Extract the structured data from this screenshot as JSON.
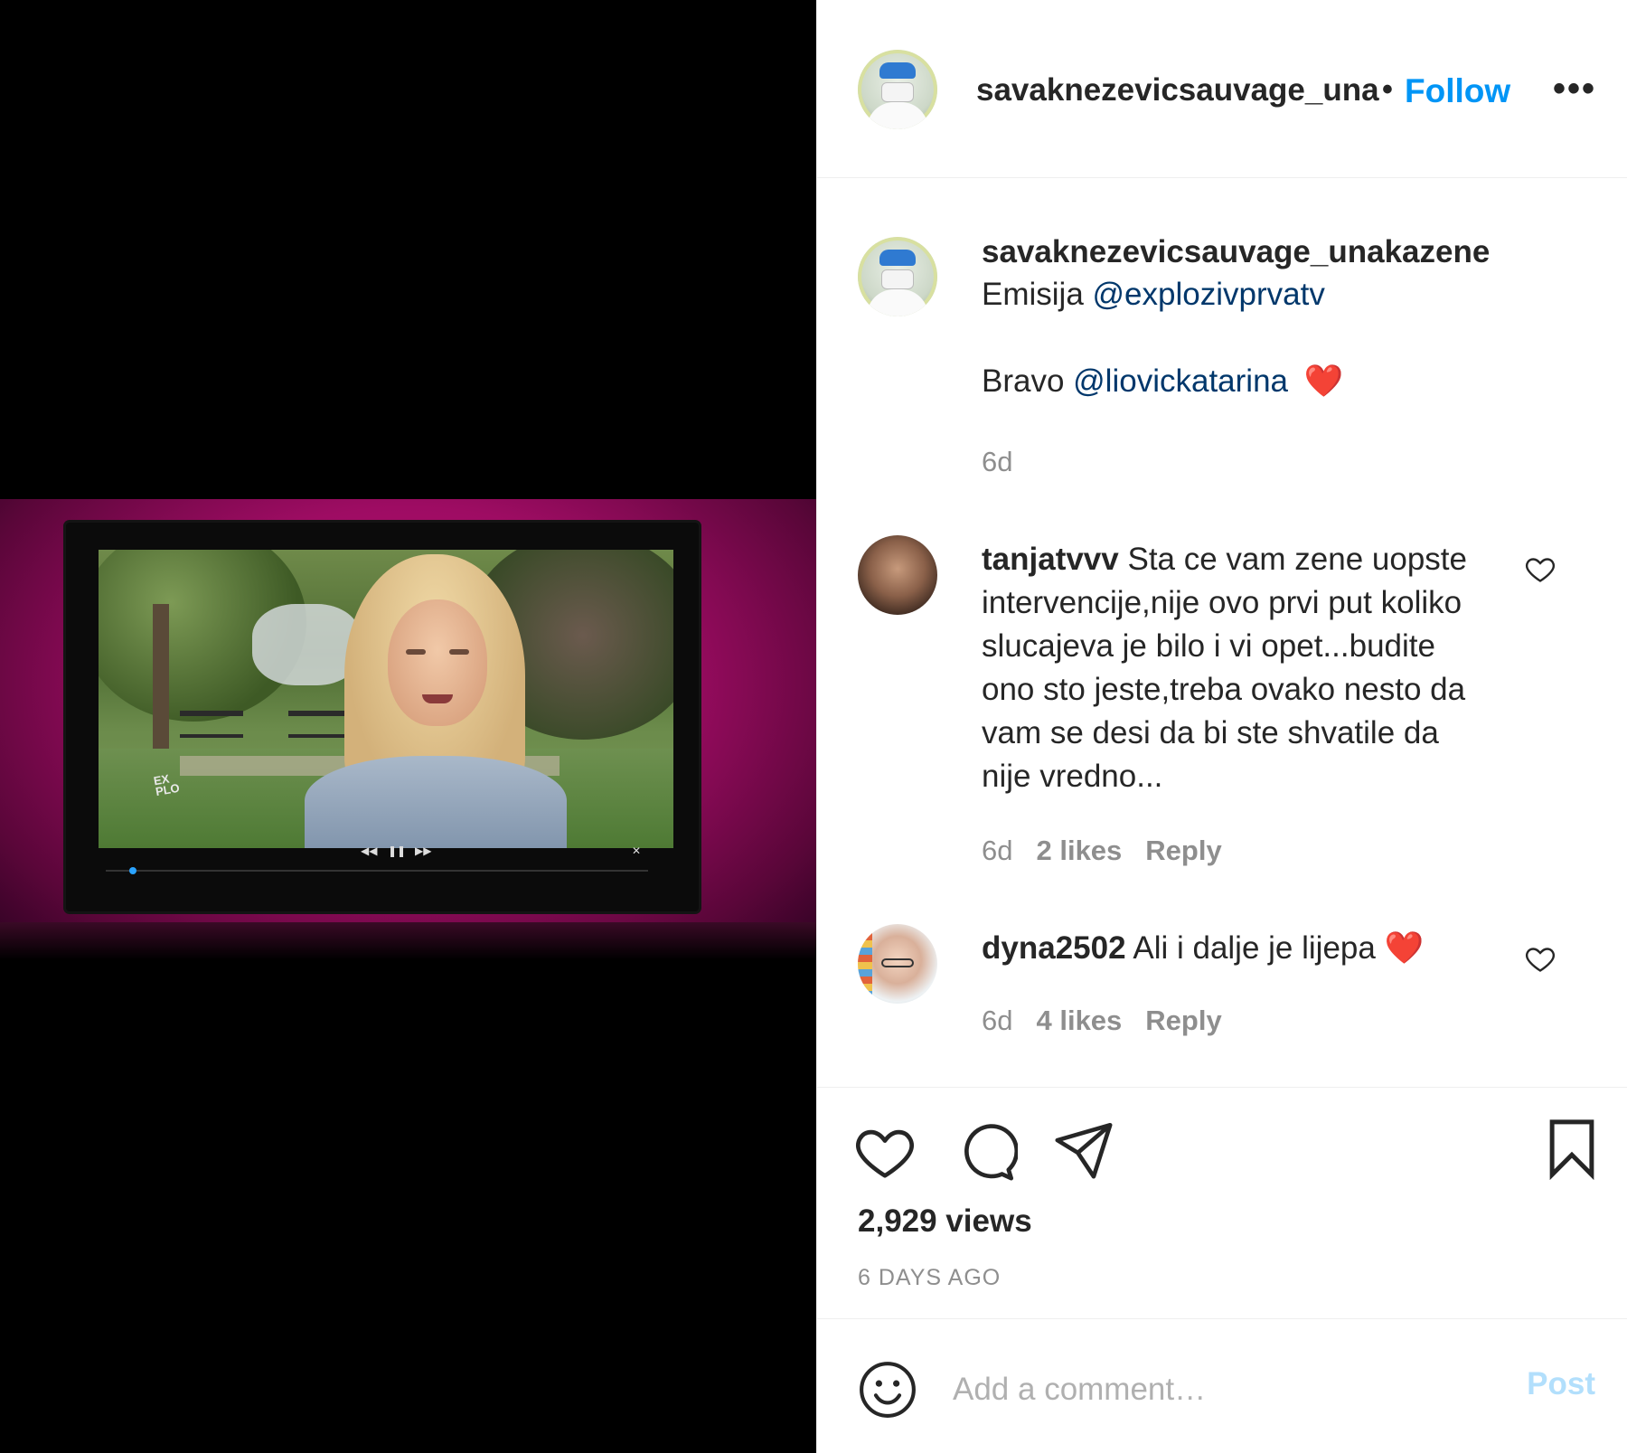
{
  "header": {
    "username": "savaknezevicsauvage_una",
    "separator": "•",
    "follow_label": "Follow",
    "more_label": "•••"
  },
  "caption": {
    "username": "savaknezevicsauvage_unakazene",
    "line1_prefix": "Emisija ",
    "line1_mention": "@explozivprvatv",
    "line2_prefix": "Bravo ",
    "line2_mention": "@liovickatarina",
    "line2_emoji": "❤️",
    "age": "6d"
  },
  "comments": [
    {
      "username": "tanjatvvv",
      "text": "Sta ce vam zene uopste intervencije,nije ovo prvi put koliko slucajeva je bilo i vi opet...budite ono sto jeste,treba ovako nesto da vam se desi da bi ste shvatile da nije vredno...",
      "age": "6d",
      "likes": "2 likes",
      "reply": "Reply"
    },
    {
      "username": "dyna2502",
      "text": "Ali i dalje je lijepa ",
      "emoji": "❤️",
      "age": "6d",
      "likes": "4 likes",
      "reply": "Reply"
    }
  ],
  "stats": {
    "views": "2,929 views",
    "posted": "6 DAYS AGO"
  },
  "composer": {
    "placeholder": "Add a comment…",
    "post_label": "Post"
  },
  "video": {
    "watermark": "EX\nPLO"
  },
  "colors": {
    "accent": "#0095f6",
    "mention": "#00376b",
    "muted": "#8e8e8e",
    "post_disabled": "#b2dffc",
    "heart": "#ed1c24"
  }
}
